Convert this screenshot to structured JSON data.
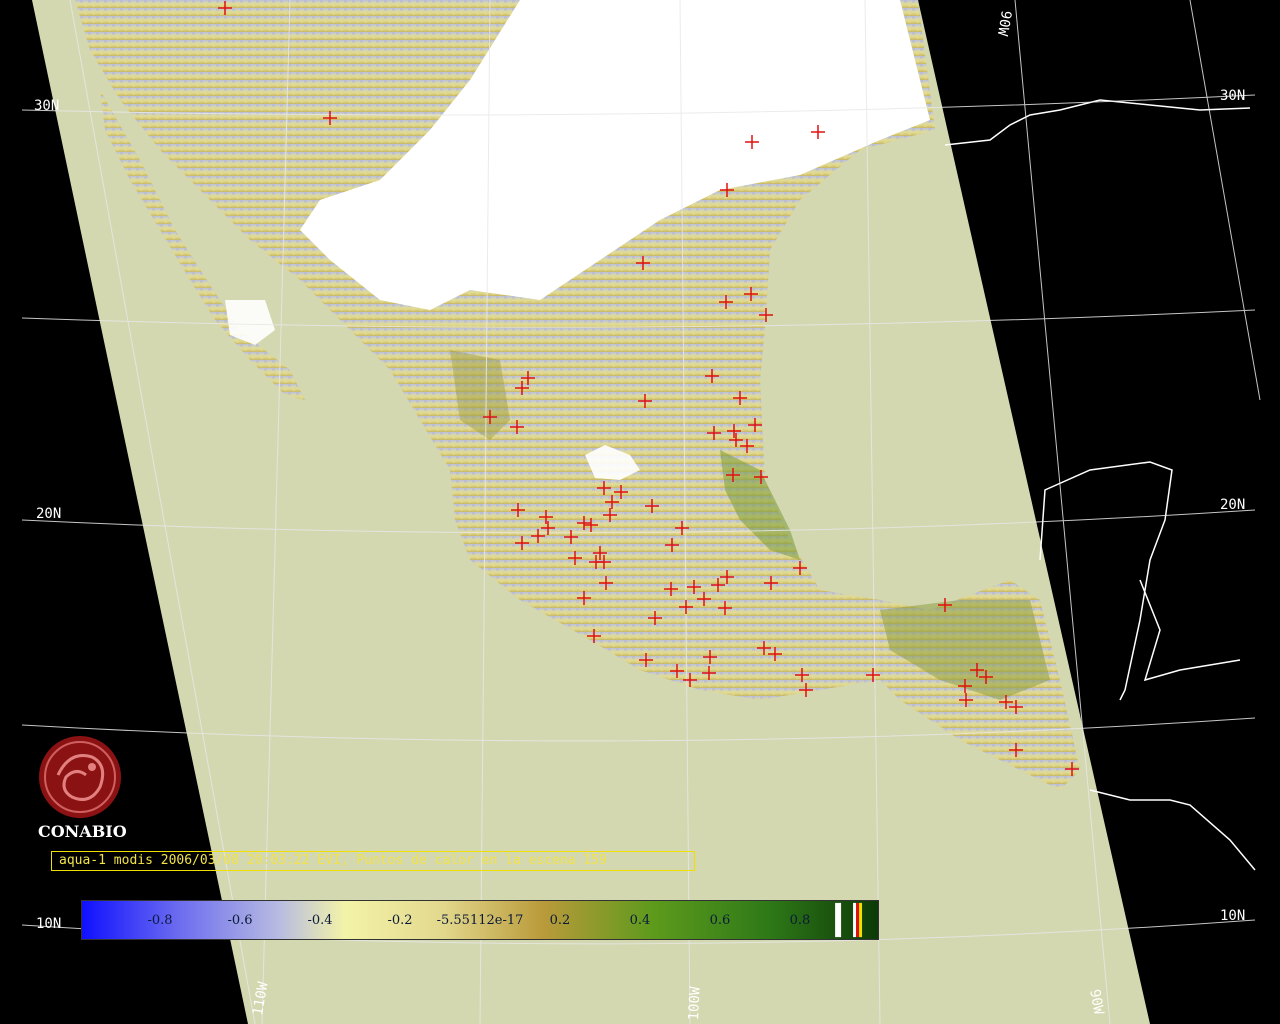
{
  "caption": "aqua-1 modis 2006/03/08 20:03:22 EVI, Puntos de calor en la escena 159",
  "logo": {
    "text": "CONABIO",
    "icon": "conabio-seal-icon"
  },
  "grid_labels": {
    "lat_30_left": "30N",
    "lat_30_right": "30N",
    "lat_20_left": "20N",
    "lat_20_right": "20N",
    "lat_10_left": "10N",
    "lat_10_right": "10N",
    "lon_110": "110W",
    "lon_100": "100W",
    "lon_90_bottom": "90W",
    "lon_90_top": "90W"
  },
  "colorbar": {
    "labels": [
      "-0.8",
      "-0.6",
      "-0.4",
      "-0.2",
      "-5.55112e-17",
      "0.2",
      "0.4",
      "0.6",
      "0.8"
    ]
  },
  "colors": {
    "swath": "#d3d8b0",
    "hotspot": "#e01010",
    "caption_border": "#f0e000"
  }
}
